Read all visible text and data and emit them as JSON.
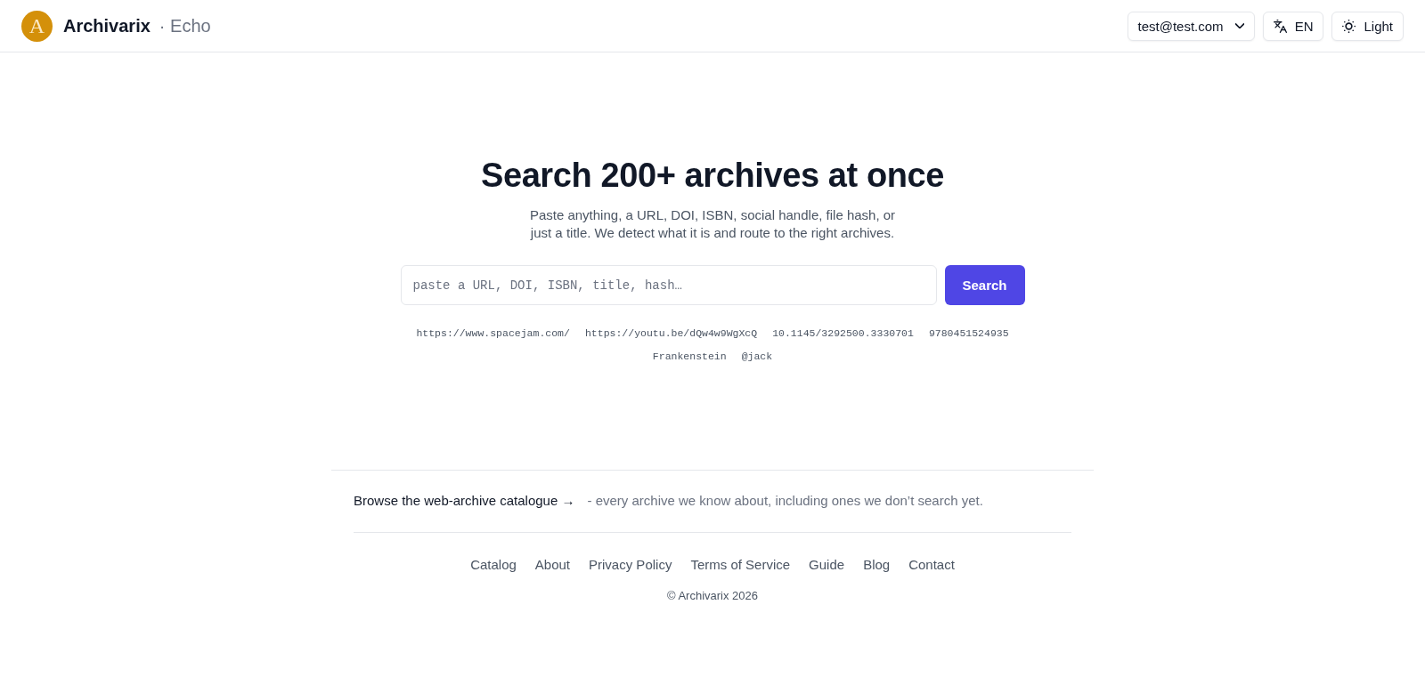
{
  "header": {
    "logo_mark": "A",
    "brand": "Archivarix",
    "product": "· Echo",
    "account": {
      "label": "test@test.com"
    },
    "language": {
      "label": "EN"
    },
    "theme": {
      "label": "Light"
    }
  },
  "hero": {
    "title": "Search 200+ archives at once",
    "subtitle": "Paste anything, a URL, DOI, ISBN, social handle, file hash, or just a title. We detect what it is and route to the right archives.",
    "search": {
      "placeholder": "paste a URL, DOI, ISBN, title, hash…",
      "button": "Search"
    },
    "examples": [
      "https://www.spacejam.com/",
      "https://youtu.be/dQw4w9WgXcQ",
      "10.1145/3292500.3330701",
      "9780451524935",
      "Frankenstein",
      "@jack"
    ]
  },
  "catalogue": {
    "link": "Browse the web-archive catalogue →",
    "description": "- every archive we know about, including ones we don’t search yet."
  },
  "footer": {
    "links": [
      "Catalog",
      "About",
      "Privacy Policy",
      "Terms of Service",
      "Guide",
      "Blog",
      "Contact"
    ],
    "copyright": "© Archivarix 2026"
  }
}
